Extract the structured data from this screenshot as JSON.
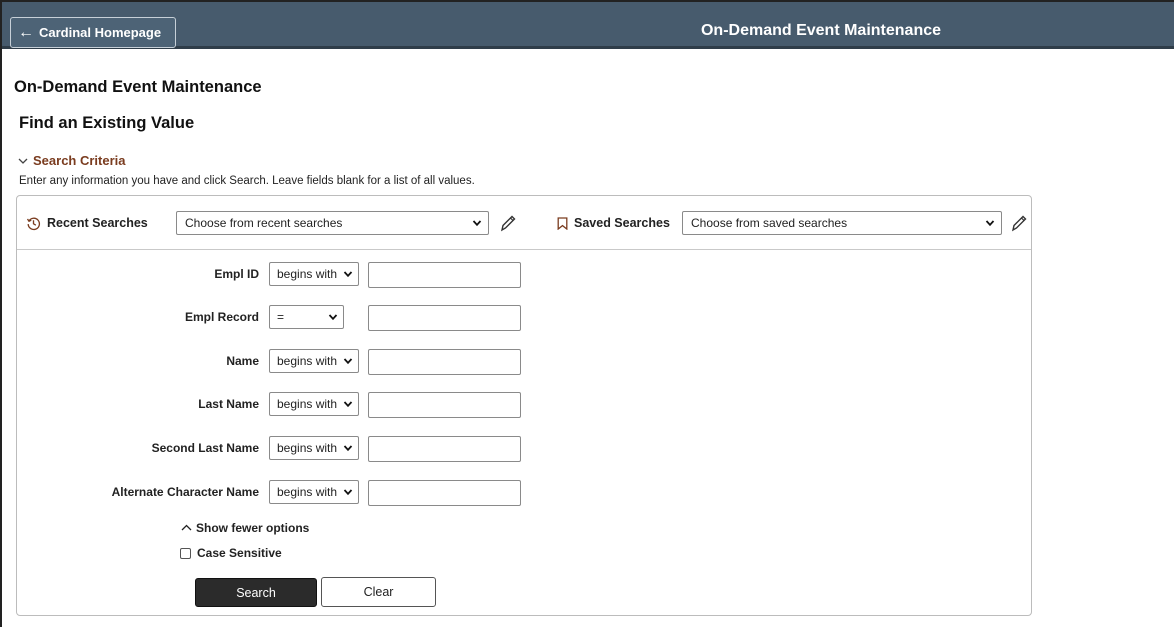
{
  "banner": {
    "home_label": "Cardinal Homepage",
    "title": "On-Demand Event Maintenance"
  },
  "page": {
    "title": "On-Demand Event Maintenance",
    "subtitle": "Find an Existing Value"
  },
  "criteria": {
    "toggle_label": "Search Criteria",
    "instructions": "Enter any information you have and click Search. Leave fields blank for a list of all values."
  },
  "recent": {
    "label": "Recent Searches",
    "placeholder": "Choose from recent searches",
    "icon": "history-icon"
  },
  "saved": {
    "label": "Saved Searches",
    "placeholder": "Choose from saved searches",
    "icon": "bookmark-icon"
  },
  "fields": [
    {
      "label": "Empl ID",
      "operator": "begins with",
      "value": ""
    },
    {
      "label": "Empl Record",
      "operator": "=",
      "value": ""
    },
    {
      "label": "Name",
      "operator": "begins with",
      "value": ""
    },
    {
      "label": "Last Name",
      "operator": "begins with",
      "value": ""
    },
    {
      "label": "Second Last Name",
      "operator": "begins with",
      "value": ""
    },
    {
      "label": "Alternate Character Name",
      "operator": "begins with",
      "value": ""
    }
  ],
  "options": {
    "fewer_label": "Show fewer options",
    "case_label": "Case Sensitive",
    "case_checked": false
  },
  "buttons": {
    "search": "Search",
    "clear": "Clear"
  },
  "colors": {
    "banner": "#475b6d",
    "criteria_link": "#7a3c1f",
    "search_button": "#2b2b2b"
  }
}
